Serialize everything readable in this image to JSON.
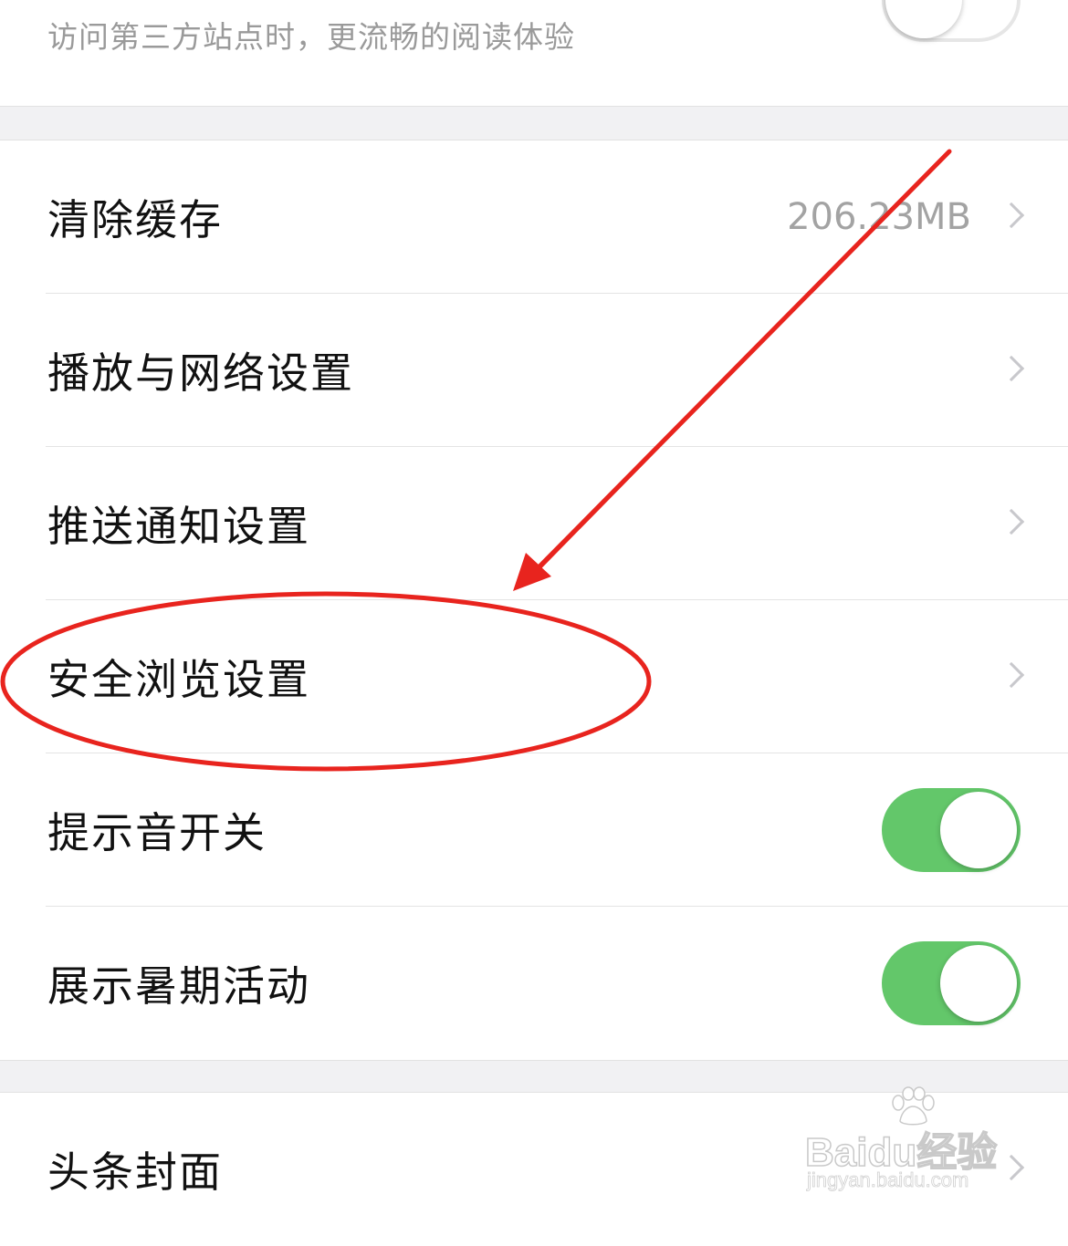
{
  "top_item": {
    "subtitle": "访问第三方站点时，更流畅的阅读体验",
    "toggle_on": false
  },
  "settings": {
    "items": [
      {
        "label": "清除缓存",
        "value": "206.23MB",
        "control": "chevron"
      },
      {
        "label": "播放与网络设置",
        "value": "",
        "control": "chevron"
      },
      {
        "label": "推送通知设置",
        "value": "",
        "control": "chevron"
      },
      {
        "label": "安全浏览设置",
        "value": "",
        "control": "chevron"
      },
      {
        "label": "提示音开关",
        "value": "",
        "control": "toggle",
        "toggle_on": true
      },
      {
        "label": "展示暑期活动",
        "value": "",
        "control": "toggle",
        "toggle_on": true
      }
    ]
  },
  "settings_2": {
    "items": [
      {
        "label": "头条封面",
        "control": "chevron"
      }
    ]
  },
  "annotation": {
    "color": "#e8241e",
    "highlighted_item": "安全浏览设置"
  },
  "watermark": {
    "brand": "Baidu经验",
    "url": "jingyan.baidu.com"
  },
  "colors": {
    "toggle_on": "#63c76a",
    "secondary_text": "#a3a3a3",
    "section_gap": "#f1f1f3"
  }
}
